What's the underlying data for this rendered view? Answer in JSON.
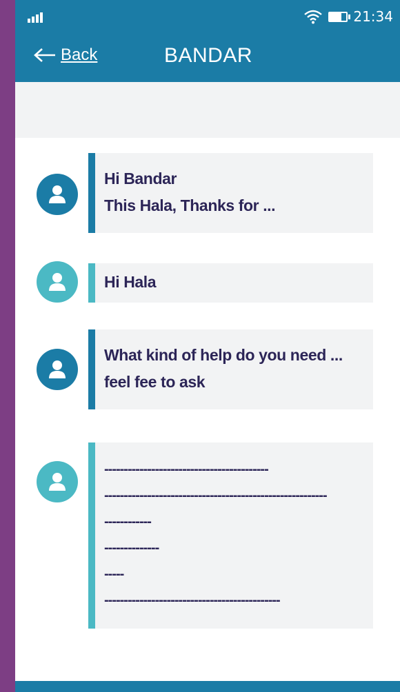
{
  "status_bar": {
    "time": "21:34",
    "signal_icon": "signal-icon",
    "wifi_icon": "wifi-icon",
    "battery_icon": "battery-icon"
  },
  "nav": {
    "back_label": "Back",
    "back_icon": "arrow-left-icon",
    "title": "BANDAR"
  },
  "colors": {
    "primary": "#1b7ca6",
    "accent": "#4bb9c4",
    "text": "#2c2557",
    "bubble_bg": "#f2f3f4",
    "frame": "#7d3e84"
  },
  "messages": [
    {
      "sender": "other",
      "lines": [
        "Hi Bandar",
        "This Hala, Thanks for ..."
      ]
    },
    {
      "sender": "self",
      "lines": [
        "Hi Hala"
      ]
    },
    {
      "sender": "other",
      "lines": [
        "What kind of help do you need ...",
        "feel fee to ask"
      ]
    },
    {
      "sender": "self",
      "lines": [
        "------------------------------------------",
        "---------------------------------------------------------",
        "------------",
        "--------------",
        "-----",
        "---------------------------------------------"
      ]
    }
  ]
}
